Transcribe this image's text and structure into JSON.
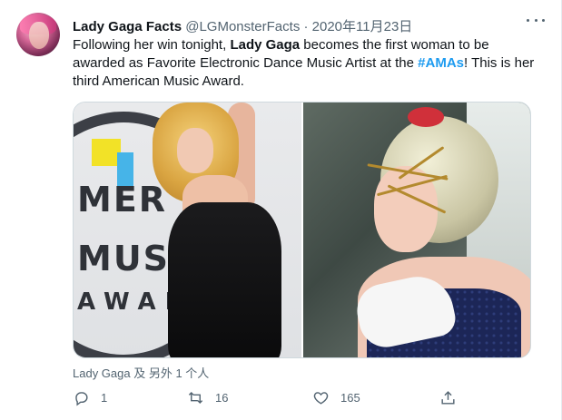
{
  "tweet": {
    "author": {
      "display_name": "Lady Gaga Facts",
      "handle": "@LGMonsterFacts",
      "separator": "·",
      "date": "2020年11月23日",
      "avatar_icon": "avatar-image"
    },
    "more_icon": "more-horizontal-icon",
    "text": {
      "part1": "Following her win tonight, ",
      "bold1": "Lady Gaga",
      "part2": " becomes the first woman to be awarded as Favorite Electronic Dance Music Artist at the ",
      "hashtag": "#AMAs",
      "part3": "! This is her third American Music Award."
    },
    "media": {
      "left_photo": {
        "backdrop_text": [
          "MER",
          "MUSI",
          "AWAR"
        ]
      },
      "right_photo": {}
    },
    "tagged": "Lady Gaga 及 另外 1 个人",
    "actions": {
      "reply": {
        "icon": "reply-icon",
        "count": "1"
      },
      "retweet": {
        "icon": "retweet-icon",
        "count": "16"
      },
      "like": {
        "icon": "heart-icon",
        "count": "165"
      },
      "share": {
        "icon": "share-icon"
      }
    }
  },
  "colors": {
    "text_primary": "#0f1419",
    "text_secondary": "#536471",
    "link": "#1d9bf0",
    "border": "#cfd9de"
  }
}
